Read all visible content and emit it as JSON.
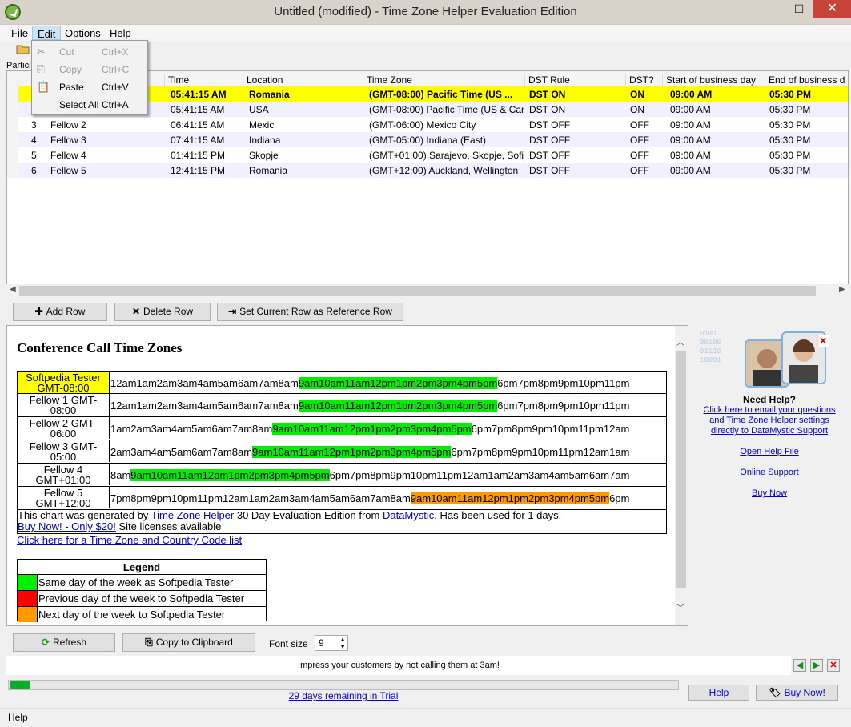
{
  "window": {
    "title": "Untitled (modified) - Time Zone Helper Evaluation Edition",
    "minimize": "—",
    "maximize": "☐",
    "close": "✕"
  },
  "menubar": {
    "items": [
      "File",
      "Edit",
      "Options",
      "Help"
    ]
  },
  "edit_menu": {
    "items": [
      {
        "label": "Cut",
        "accel": "Ctrl+X",
        "enabled": false,
        "icon": "scissors-icon"
      },
      {
        "label": "Copy",
        "accel": "Ctrl+C",
        "enabled": false,
        "icon": "copy-icon"
      },
      {
        "label": "Paste",
        "accel": "Ctrl+V",
        "enabled": true,
        "icon": "paste-icon"
      },
      {
        "label": "Select All",
        "accel": "Ctrl+A",
        "enabled": true,
        "icon": ""
      }
    ]
  },
  "participants_label": "Particip",
  "grid": {
    "columns": [
      "Time",
      "Location",
      "Time Zone",
      "DST Rule",
      "DST?",
      "Start of business day",
      "End of business d"
    ],
    "rows": [
      {
        "num": "",
        "name": "",
        "time": "05:41:15 AM",
        "location": "Romania",
        "tz": "(GMT-08:00) Pacific Time (US ...",
        "rule": "DST ON",
        "dst": "ON",
        "start": "09:00 AM",
        "end": "05:30 PM",
        "selected": true
      },
      {
        "num": "",
        "name": "",
        "time": "05:41:15 AM",
        "location": "USA",
        "tz": "(GMT-08:00) Pacific Time (US & Can...",
        "rule": "DST ON",
        "dst": "ON",
        "start": "09:00 AM",
        "end": "05:30 PM"
      },
      {
        "num": "3",
        "name": "Fellow 2",
        "time": "06:41:15 AM",
        "location": "Mexic",
        "tz": "(GMT-06:00) Mexico City",
        "rule": "DST OFF",
        "dst": "OFF",
        "start": "09:00 AM",
        "end": "05:30 PM"
      },
      {
        "num": "4",
        "name": "Fellow 3",
        "time": "07:41:15 AM",
        "location": "Indiana",
        "tz": "(GMT-05:00) Indiana (East)",
        "rule": "DST OFF",
        "dst": "OFF",
        "start": "09:00 AM",
        "end": "05:30 PM"
      },
      {
        "num": "5",
        "name": "Fellow 4",
        "time": "01:41:15 PM",
        "location": "Skopje",
        "tz": "(GMT+01:00) Sarajevo, Skopje, Sofij...",
        "rule": "DST OFF",
        "dst": "OFF",
        "start": "09:00 AM",
        "end": "05:30 PM"
      },
      {
        "num": "6",
        "name": "Fellow 5",
        "time": "12:41:15 PM",
        "location": "Romania",
        "tz": "(GMT+12:00) Auckland, Wellington",
        "rule": "DST OFF",
        "dst": "OFF",
        "start": "09:00 AM",
        "end": "05:30 PM"
      }
    ]
  },
  "buttons": {
    "add_row": "Add Row",
    "delete_row": "Delete Row",
    "set_reference": "Set Current Row as Reference Row",
    "refresh": "Refresh",
    "copy_clipboard": "Copy to Clipboard",
    "help": "Help",
    "buy_now": "Buy Now!"
  },
  "report": {
    "title": "Conference Call Time Zones",
    "rows": [
      {
        "name1": "Softpedia Tester",
        "name2": "GMT-08:00",
        "highlight": true,
        "pre": "12am1am2am3am4am5am6am7am8am",
        "mid": "9am10am11am12pm1pm2pm3pm4pm5pm",
        "post": "6pm7pm8pm9pm10pm11pm",
        "color": "g"
      },
      {
        "name1": "Fellow 1 GMT-",
        "name2": "08:00",
        "pre": "12am1am2am3am4am5am6am7am8am",
        "mid": "9am10am11am12pm1pm2pm3pm4pm5pm",
        "post": "6pm7pm8pm9pm10pm11pm",
        "color": "g"
      },
      {
        "name1": "Fellow 2 GMT-",
        "name2": "06:00",
        "pre": "1am2am3am4am5am6am7am8am",
        "mid": "9am10am11am12pm1pm2pm3pm4pm5pm",
        "post": "6pm7pm8pm9pm10pm11pm12am",
        "color": "g"
      },
      {
        "name1": "Fellow 3 GMT-",
        "name2": "05:00",
        "pre": "2am3am4am5am6am7am8am",
        "mid": "9am10am11am12pm1pm2pm3pm4pm5pm",
        "post": "6pm7pm8pm9pm10pm11pm12am1am",
        "color": "g"
      },
      {
        "name1": "Fellow 4",
        "name2": "GMT+01:00",
        "pre": "8am",
        "mid": "9am10am11am12pm1pm2pm3pm4pm5pm",
        "post": "6pm7pm8pm9pm10pm11pm12am1am2am3am4am5am6am7am",
        "color": "g"
      },
      {
        "name1": "Fellow 5",
        "name2": "GMT+12:00",
        "pre": "7pm8pm9pm10pm11pm12am1am2am3am4am5am6am7am8am",
        "mid": "9am10am11am12pm1pm2pm3pm4pm5pm",
        "post": "6pm",
        "color": "o"
      }
    ],
    "note_pre": "This chart was generated by ",
    "note_link1": "Time Zone Helper",
    "note_mid": " 30 Day Evaluation Edition from ",
    "note_link2": "DataMystic",
    "note_post": ". Has been used for 1 days.",
    "buy_link": "Buy Now! - Only $20!",
    "site_licenses": " Site licenses available",
    "tz_code_link": "Click here for a Time Zone and Country Code list",
    "legend_title": "Legend",
    "legend": [
      {
        "color": "#00ee00",
        "text": "Same day of the week as Softpedia Tester"
      },
      {
        "color": "#ff0000",
        "text": "Previous day of the week to Softpedia Tester"
      },
      {
        "color": "#ff9900",
        "text": "Next day of the week to Softpedia Tester"
      }
    ]
  },
  "ad": {
    "need_help": "Need Help?",
    "email_link_1": "Click here to email your questions",
    "email_link_2": "and Time Zone Helper settings",
    "email_link_3": "directly to DataMystic Support",
    "open_help": "Open Help File",
    "online_support": "Online Support",
    "buy_now": "Buy Now"
  },
  "font_size_label": "Font size",
  "font_size_value": "9",
  "tip": "Impress your customers by not calling them at 3am!",
  "trial": {
    "text": "29 days remaining in Trial",
    "progress": 0.03
  },
  "status": "Help",
  "colors": {
    "selected_row": "#ffff00",
    "same_day": "#00ee00",
    "next_day": "#ff9900",
    "link": "#0000cc"
  }
}
